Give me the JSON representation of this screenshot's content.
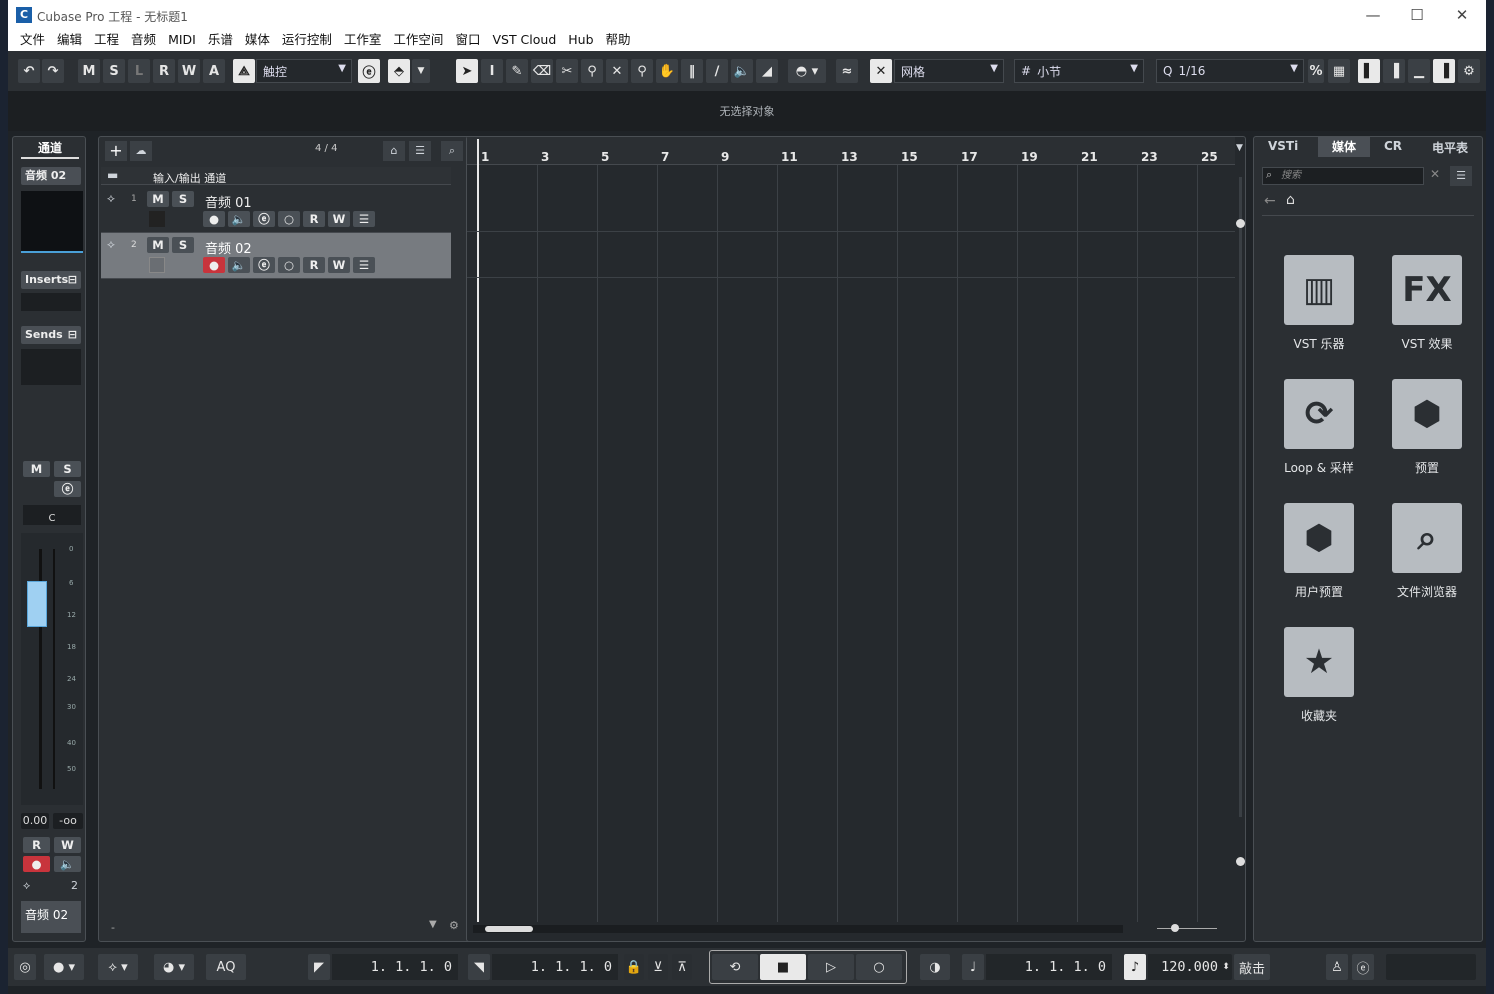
{
  "window": {
    "title": "Cubase Pro 工程 - 无标题1",
    "logo": "C",
    "minimize": "—",
    "maximize": "☐",
    "close": "✕"
  },
  "menu": [
    "文件",
    "编辑",
    "工程",
    "音频",
    "MIDI",
    "乐谱",
    "媒体",
    "运行控制",
    "工作室",
    "工作空间",
    "窗口",
    "VST Cloud",
    "Hub",
    "帮助"
  ],
  "toolbar": {
    "undo": "↶",
    "redo": "↷",
    "m": "M",
    "s": "S",
    "l": "L",
    "r": "R",
    "w": "W",
    "a": "A",
    "automation_mode": "触控",
    "grid_type": "网格",
    "grid_unit": "小节",
    "quantize": "1/16",
    "cross_icon": "✕"
  },
  "infoline": {
    "text": "无选择对象"
  },
  "inspector": {
    "tab": "通道",
    "track_name": "音频 02",
    "inserts": "Inserts",
    "sends": "Sends",
    "m": "M",
    "s": "S",
    "pan": "C",
    "volume": "0.00",
    "peak": "-oo",
    "r": "R",
    "w": "W",
    "channel_number": "2",
    "footer_name": "音频 02",
    "fader_scale": [
      "0",
      "6",
      "12",
      "18",
      "24",
      "30",
      "40",
      "50"
    ]
  },
  "tracklist": {
    "signature": "4 / 4",
    "header_label": "输入/输出 通道",
    "tracks": [
      {
        "num": "1",
        "name": "音频 01",
        "m": "M",
        "s": "S",
        "r": "R",
        "w": "W"
      },
      {
        "num": "2",
        "name": "音频 02",
        "m": "M",
        "s": "S",
        "r": "R",
        "w": "W"
      }
    ],
    "footer_dash": "-"
  },
  "ruler": {
    "bars": [
      "1",
      "3",
      "5",
      "7",
      "9",
      "11",
      "13",
      "15",
      "17",
      "19",
      "21",
      "23",
      "25"
    ]
  },
  "right_zone": {
    "tabs": [
      "VSTi",
      "媒体",
      "CR",
      "电平表"
    ],
    "active_tab": "媒体",
    "search_placeholder": "搜索",
    "tiles": [
      {
        "label": "VST 乐器",
        "icon": "piano-icon"
      },
      {
        "label": "VST 效果",
        "icon": "fx-icon",
        "glyph": "FX"
      },
      {
        "label": "Loop & 采样",
        "icon": "loop-icon",
        "glyph": "⟳"
      },
      {
        "label": "预置",
        "icon": "preset-icon",
        "glyph": "⬢"
      },
      {
        "label": "用户预置",
        "icon": "user-preset-icon",
        "glyph": "⬢"
      },
      {
        "label": "文件浏览器",
        "icon": "file-browser-icon",
        "glyph": "⌕"
      },
      {
        "label": "收藏夹",
        "icon": "star-icon",
        "glyph": "★"
      }
    ]
  },
  "transport": {
    "left_locator": "1.  1.  1.     0",
    "right_locator": "1.  1.  1.     0",
    "position": "1.  1.  1.     0",
    "tempo": "120.000",
    "tap": "敲击",
    "aq": "AQ"
  }
}
